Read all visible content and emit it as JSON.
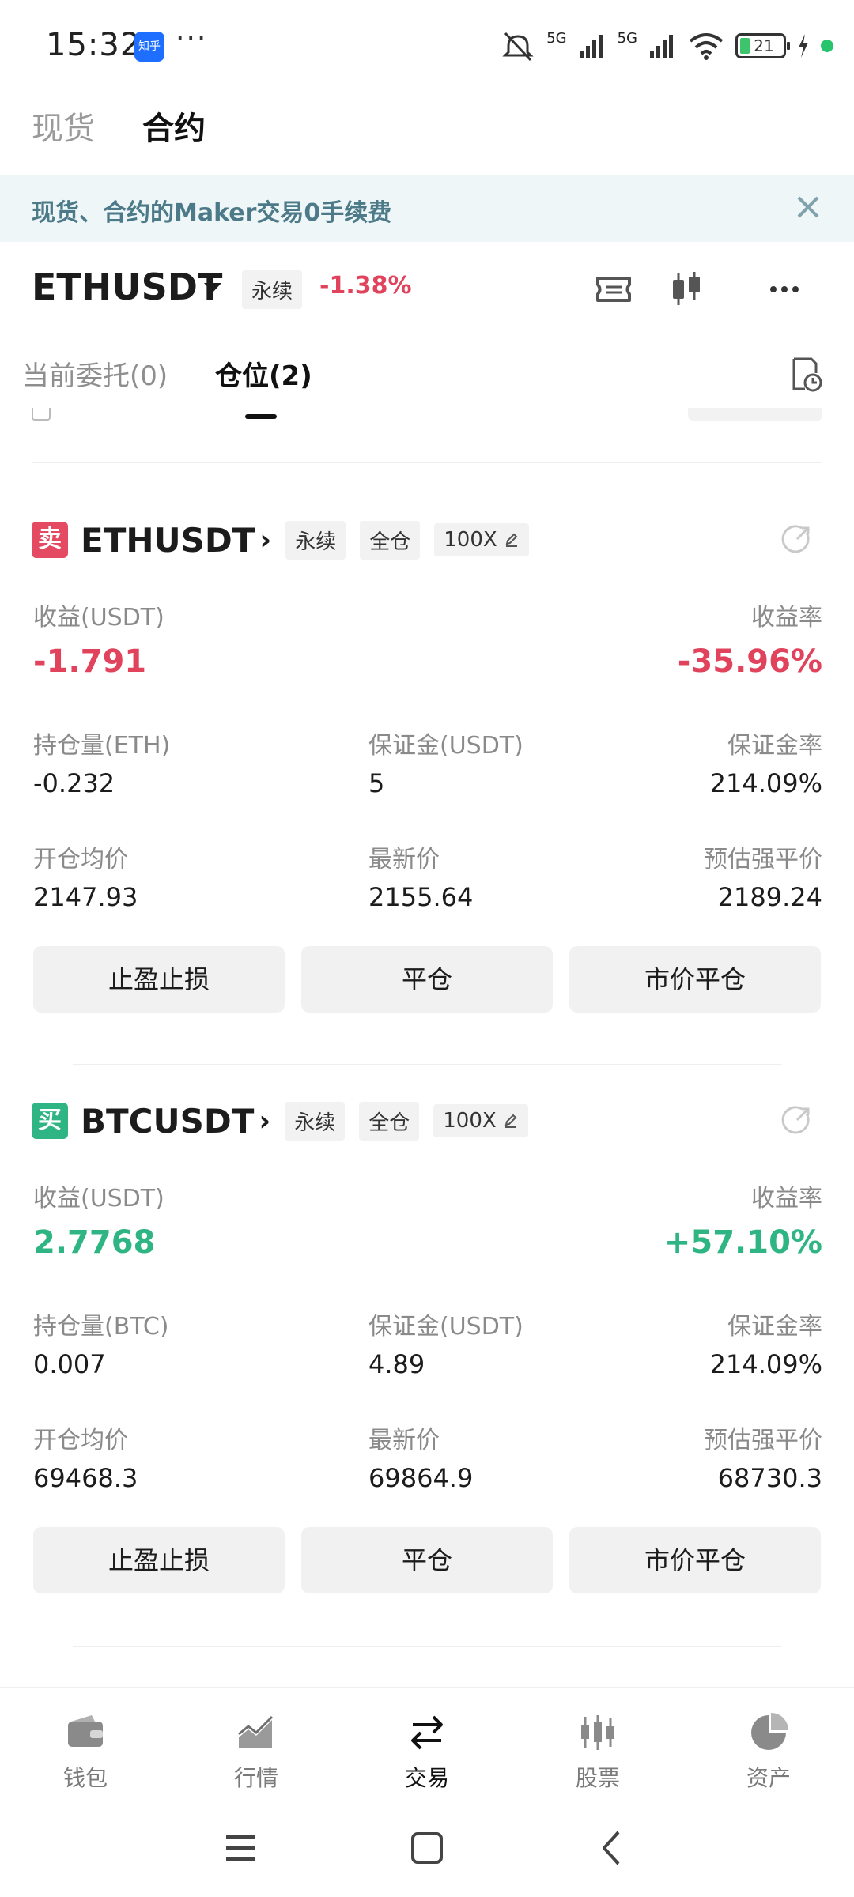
{
  "status_bar": {
    "time": "15:32",
    "app_badge": "知乎",
    "more": "···",
    "network1": "5G",
    "network2": "5G",
    "battery": "21"
  },
  "top_tabs": {
    "spot": "现货",
    "contract": "合约"
  },
  "banner": {
    "text": "现货、合约的Maker交易0手续费"
  },
  "pair_header": {
    "symbol": "ETHUSDT",
    "type": "永续",
    "change": "-1.38%"
  },
  "position_tabs": {
    "open_orders": "当前委托(0)",
    "positions": "仓位(2)"
  },
  "positions": [
    {
      "side": "卖",
      "symbol": "ETHUSDT",
      "type": "永续",
      "margin_mode": "全仓",
      "leverage": "100X",
      "pnl_label": "收益(USDT)",
      "pnl": "-1.791",
      "roi_label": "收益率",
      "roi": "-35.96%",
      "size_label": "持仓量(ETH)",
      "size": "-0.232",
      "margin_label": "保证金(USDT)",
      "margin": "5",
      "margin_ratio_label": "保证金率",
      "margin_ratio": "214.09%",
      "entry_label": "开仓均价",
      "entry": "2147.93",
      "last_label": "最新价",
      "last": "2155.64",
      "liq_label": "预估强平价",
      "liq": "2189.24",
      "btn_tpsl": "止盈止损",
      "btn_close": "平仓",
      "btn_market_close": "市价平仓"
    },
    {
      "side": "买",
      "symbol": "BTCUSDT",
      "type": "永续",
      "margin_mode": "全仓",
      "leverage": "100X",
      "pnl_label": "收益(USDT)",
      "pnl": "2.7768",
      "roi_label": "收益率",
      "roi": "+57.10%",
      "size_label": "持仓量(BTC)",
      "size": "0.007",
      "margin_label": "保证金(USDT)",
      "margin": "4.89",
      "margin_ratio_label": "保证金率",
      "margin_ratio": "214.09%",
      "entry_label": "开仓均价",
      "entry": "69468.3",
      "last_label": "最新价",
      "last": "69864.9",
      "liq_label": "预估强平价",
      "liq": "68730.3",
      "btn_tpsl": "止盈止损",
      "btn_close": "平仓",
      "btn_market_close": "市价平仓"
    }
  ],
  "bottom_nav": [
    {
      "label": "钱包",
      "icon": "wallet-icon"
    },
    {
      "label": "行情",
      "icon": "market-chart-icon"
    },
    {
      "label": "交易",
      "icon": "trade-arrows-icon"
    },
    {
      "label": "股票",
      "icon": "stocks-icon"
    },
    {
      "label": "资产",
      "icon": "assets-pie-icon"
    }
  ],
  "colors": {
    "negative": "#e0435b",
    "positive": "#2fb583",
    "banner_bg": "#eef6f8",
    "banner_text": "#4d7a88"
  }
}
